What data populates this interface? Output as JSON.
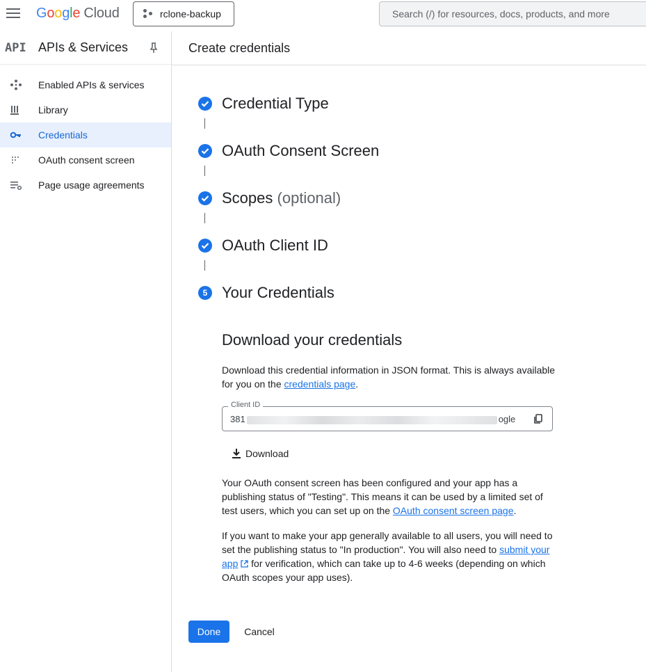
{
  "topbar": {
    "logo_letters": [
      "G",
      "o",
      "o",
      "g",
      "l",
      "e"
    ],
    "logo_suffix": "Cloud",
    "project": "rclone-backup",
    "search_placeholder": "Search (/) for resources, docs, products, and more"
  },
  "sidebar": {
    "api_badge": "API",
    "title": "APIs & Services",
    "items": [
      {
        "label": "Enabled APIs & services",
        "icon": "grid-diamond-icon",
        "active": false
      },
      {
        "label": "Library",
        "icon": "library-icon",
        "active": false
      },
      {
        "label": "Credentials",
        "icon": "key-icon",
        "active": true
      },
      {
        "label": "OAuth consent screen",
        "icon": "dotted-grid-icon",
        "active": false
      },
      {
        "label": "Page usage agreements",
        "icon": "list-settings-icon",
        "active": false
      }
    ]
  },
  "main": {
    "title": "Create credentials",
    "steps": [
      {
        "label": "Credential Type",
        "status": "done"
      },
      {
        "label": "OAuth Consent Screen",
        "status": "done"
      },
      {
        "label": "Scopes",
        "suffix": "(optional)",
        "status": "done"
      },
      {
        "label": "OAuth Client ID",
        "status": "done"
      },
      {
        "label": "Your Credentials",
        "status": "current",
        "number": "5"
      }
    ],
    "download_section": {
      "title": "Download your credentials",
      "intro_text": "Download this credential information in JSON format. This is always available for you on the",
      "intro_link": "credentials page",
      "intro_end": ".",
      "client_id_label": "Client ID",
      "client_id_prefix": "381",
      "client_id_suffix": "ogle",
      "download_label": "Download",
      "consent_text": "Your OAuth consent screen has been configured and your app has a publishing status of \"Testing\". This means it can be used by a limited set of test users, which you can set up on the",
      "consent_link": "OAuth consent screen page",
      "consent_end": ".",
      "production_text": "If you want to make your app generally available to all users, you will need to set the publishing status to \"In production\". You will also need to",
      "production_link": "submit your app",
      "production_end": "for verification, which can take up to 4-6 weeks (depending on which OAuth scopes your app uses)."
    },
    "buttons": {
      "done": "Done",
      "cancel": "Cancel"
    }
  },
  "colors": {
    "accent": "#1a73e8",
    "active_bg": "#e8f0fe",
    "active_text": "#1967d2"
  }
}
